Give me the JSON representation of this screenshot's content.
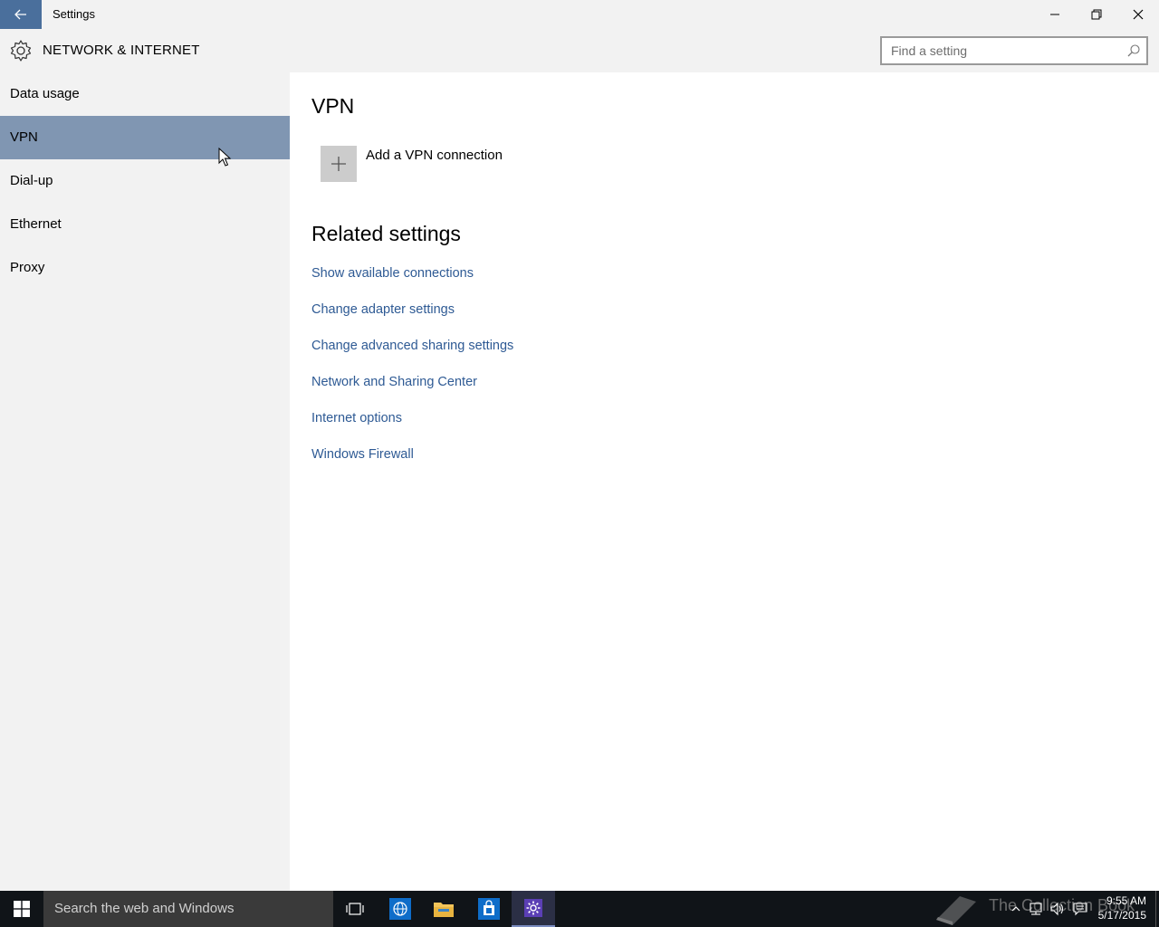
{
  "window": {
    "title": "Settings",
    "back_icon": "arrow-left-icon",
    "minimize_icon": "minimize-icon",
    "restore_icon": "restore-icon",
    "close_icon": "close-icon"
  },
  "header": {
    "icon": "gear-icon",
    "title": "NETWORK & INTERNET",
    "search": {
      "placeholder": "Find a setting",
      "value": ""
    }
  },
  "sidebar": {
    "items": [
      {
        "label": "Data usage",
        "selected": false
      },
      {
        "label": "VPN",
        "selected": true
      },
      {
        "label": "Dial-up",
        "selected": false
      },
      {
        "label": "Ethernet",
        "selected": false
      },
      {
        "label": "Proxy",
        "selected": false
      }
    ]
  },
  "main": {
    "title": "VPN",
    "add_vpn_label": "Add a VPN connection",
    "related_title": "Related settings",
    "links": [
      "Show available connections",
      "Change adapter settings",
      "Change advanced sharing settings",
      "Network and Sharing Center",
      "Internet options",
      "Windows Firewall"
    ]
  },
  "taskbar": {
    "search_placeholder": "Search the web and Windows",
    "watermark": "The Collection Book",
    "time": "9:55 AM",
    "date": "5/17/2015"
  },
  "colors": {
    "accent": "#4a6f9c",
    "selected_nav": "#8096b2",
    "link": "#2e5a94",
    "taskbar": "#101418"
  }
}
